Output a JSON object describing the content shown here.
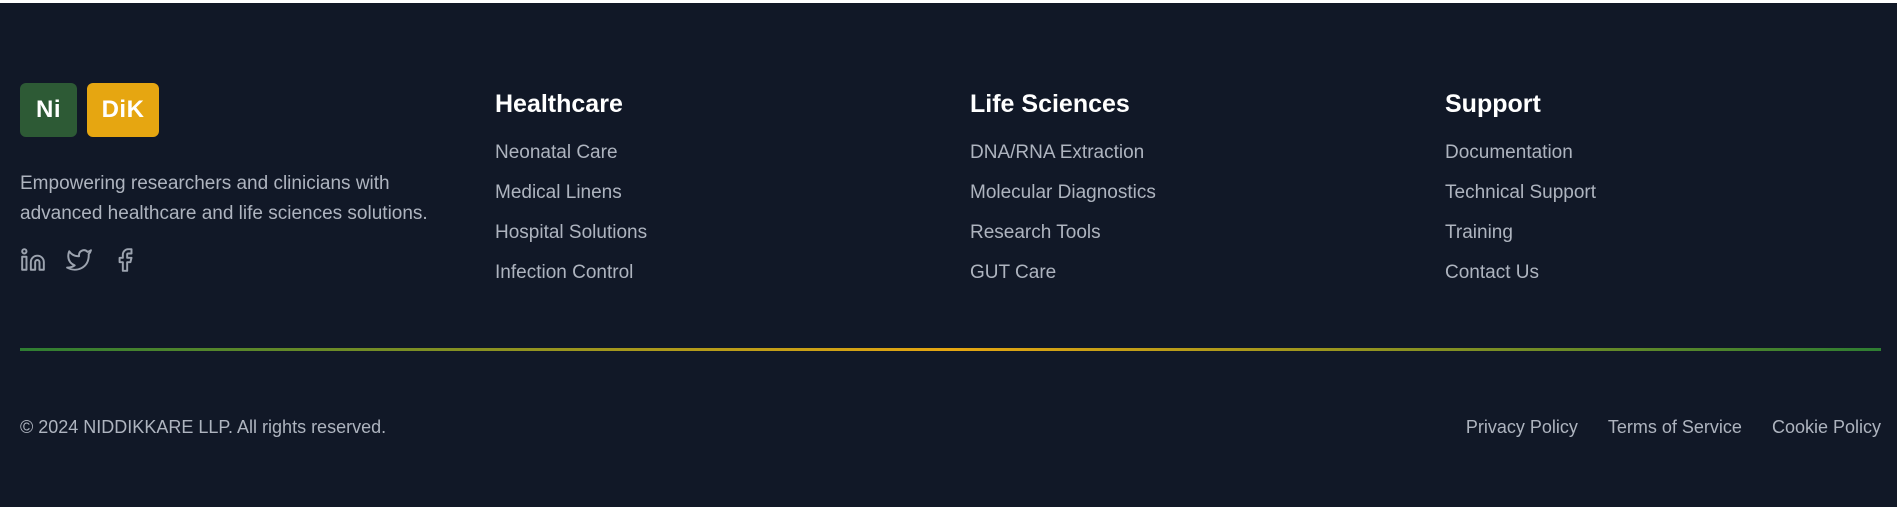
{
  "brand": {
    "logo_part1": "Ni",
    "logo_part2": "DiK",
    "description": "Empowering researchers and clinicians with advanced healthcare and life sciences solutions.",
    "social": [
      {
        "name": "linkedin-icon"
      },
      {
        "name": "twitter-icon"
      },
      {
        "name": "facebook-icon"
      }
    ]
  },
  "columns": [
    {
      "title": "Healthcare",
      "items": [
        "Neonatal Care",
        "Medical Linens",
        "Hospital Solutions",
        "Infection Control"
      ]
    },
    {
      "title": "Life Sciences",
      "items": [
        "DNA/RNA Extraction",
        "Molecular Diagnostics",
        "Research Tools",
        "GUT Care"
      ]
    },
    {
      "title": "Support",
      "items": [
        "Documentation",
        "Technical Support",
        "Training",
        "Contact Us"
      ]
    }
  ],
  "bottom": {
    "copyright": "© 2024 NIDDIKKARE LLP. All rights reserved.",
    "links": [
      "Privacy Policy",
      "Terms of Service",
      "Cookie Policy"
    ]
  },
  "colors": {
    "background": "#111827",
    "logo_green": "#2d5a35",
    "logo_gold": "#e6a611",
    "divider_green": "#2e7d32",
    "divider_gold": "#e6a611"
  }
}
